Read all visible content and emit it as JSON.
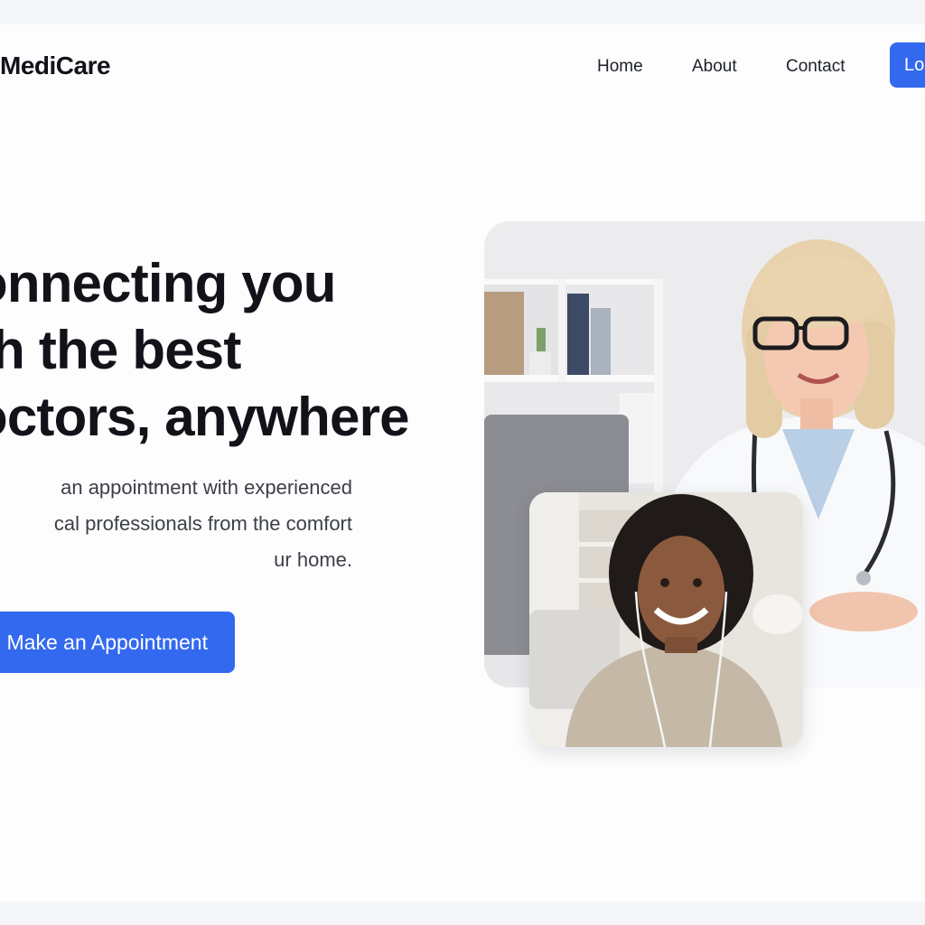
{
  "header": {
    "brand": "MediCare",
    "nav": [
      "Home",
      "About",
      "Contact"
    ],
    "login_label": "Lo"
  },
  "hero": {
    "title": "onnecting you\nth the best\noctors, anywhere",
    "subtitle_lines": [
      "an appointment with experienced",
      "cal professionals from the comfort",
      "ur home."
    ],
    "cta_label": "Make an Appointment"
  },
  "images": {
    "doctor": "doctor-photo",
    "patient": "patient-video-call-photo"
  },
  "colors": {
    "accent": "#3369ee",
    "page_bg": "#fdfdfe",
    "frame_bg": "#f5f6f9",
    "text": "#111318"
  }
}
